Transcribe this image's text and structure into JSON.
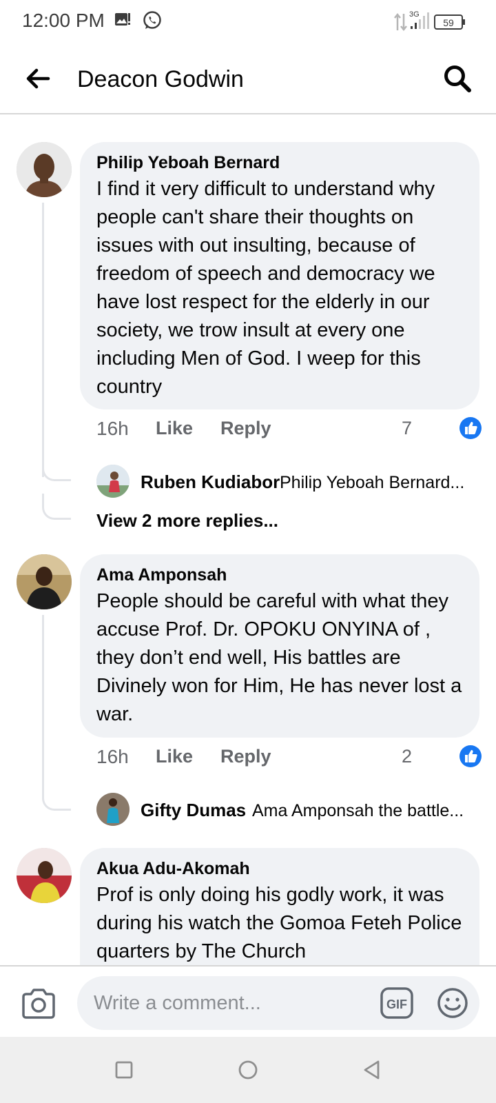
{
  "status_bar": {
    "time": "12:00 PM",
    "network": "3G",
    "battery": "59"
  },
  "header": {
    "title": "Deacon Godwin"
  },
  "comments": [
    {
      "author": "Philip Yeboah Bernard",
      "text": "I find it very difficult to understand why people can't share their thoughts on issues with out insulting, because of freedom of speech and democracy we have lost respect for the elderly in our society, we trow insult at every one including Men of God. I weep for this country",
      "time": "16h",
      "like_label": "Like",
      "reply_label": "Reply",
      "reactions": "7",
      "reply_preview": {
        "author": "Ruben Kudiabor",
        "text": "Philip Yeboah Bernard..."
      },
      "more_replies": "View 2 more replies..."
    },
    {
      "author": "Ama Amponsah",
      "text": "People should be careful with what they accuse Prof. Dr.  OPOKU ONYINA of , they don’t end well, His battles are Divinely won for Him, He has never lost a war.",
      "time": "16h",
      "like_label": "Like",
      "reply_label": "Reply",
      "reactions": "2",
      "reply_preview": {
        "author": "Gifty Dumas",
        "text": "Ama Amponsah the battle..."
      }
    },
    {
      "author": "Akua Adu-Akomah",
      "text": "Prof is only doing his godly work, it was during his watch the Gomoa Feteh Police quarters by The Church"
    }
  ],
  "composer": {
    "placeholder": "Write a comment...",
    "gif_label": "GIF"
  },
  "colors": {
    "bubble": "#f0f2f5",
    "like_blue": "#1877f2",
    "secondary_text": "#65676b"
  }
}
